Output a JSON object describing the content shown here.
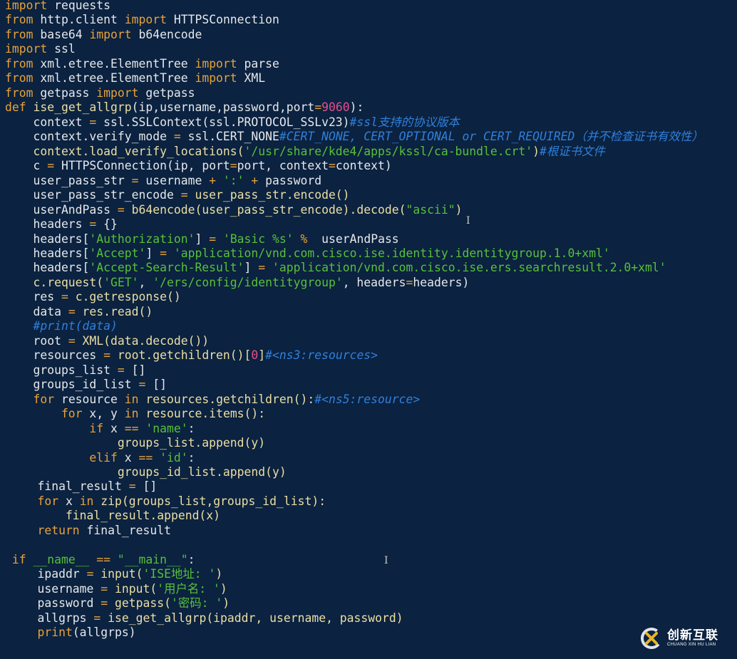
{
  "editor": {
    "lines": [
      [
        [
          "k",
          "import"
        ],
        [
          "p",
          " requests"
        ]
      ],
      [
        [
          "k",
          "from"
        ],
        [
          "p",
          " http.client "
        ],
        [
          "k",
          "import"
        ],
        [
          "p",
          " HTTPSConnection"
        ]
      ],
      [
        [
          "k",
          "from"
        ],
        [
          "p",
          " base64 "
        ],
        [
          "k",
          "import"
        ],
        [
          "p",
          " b64encode"
        ]
      ],
      [
        [
          "k",
          "import"
        ],
        [
          "p",
          " ssl"
        ]
      ],
      [
        [
          "k",
          "from"
        ],
        [
          "p",
          " xml.etree.ElementTree "
        ],
        [
          "k",
          "import"
        ],
        [
          "p",
          " parse"
        ]
      ],
      [
        [
          "k",
          "from"
        ],
        [
          "p",
          " xml.etree.ElementTree "
        ],
        [
          "k",
          "import"
        ],
        [
          "p",
          " XML"
        ]
      ],
      [
        [
          "k",
          "from"
        ],
        [
          "p",
          " getpass "
        ],
        [
          "k",
          "import"
        ],
        [
          "p",
          " getpass"
        ]
      ],
      [
        [
          "k",
          "def "
        ],
        [
          "f",
          "ise_get_allgrp"
        ],
        [
          "p",
          "(ip,username,password,port"
        ],
        [
          "o",
          "="
        ],
        [
          "n",
          "9060"
        ],
        [
          "p",
          "):"
        ]
      ],
      [
        [
          "p",
          "    context "
        ],
        [
          "o",
          "="
        ],
        [
          "p",
          " ssl.SSLContext(ssl.PROTOCOL_SSLv23)"
        ],
        [
          "c",
          "#ssl支持的协议版本"
        ]
      ],
      [
        [
          "p",
          "    context.verify_mode "
        ],
        [
          "o",
          "="
        ],
        [
          "p",
          " ssl.CERT_NONE"
        ],
        [
          "c",
          "#CERT_NONE, CERT_OPTIONAL or CERT_REQUIRED（并不检查证书有效性）"
        ]
      ],
      [
        [
          "f",
          "    context.load_verify_locations("
        ],
        [
          "s",
          "'/usr/share/kde4/apps/kssl/ca-bundle.crt'"
        ],
        [
          "f",
          ")"
        ],
        [
          "c",
          "#根证书文件"
        ]
      ],
      [
        [
          "p",
          "    c "
        ],
        [
          "o",
          "="
        ],
        [
          "p",
          " HTTPSConnection(ip, port"
        ],
        [
          "o",
          "="
        ],
        [
          "p",
          "port, context"
        ],
        [
          "o",
          "="
        ],
        [
          "p",
          "context)"
        ]
      ],
      [
        [
          "p",
          "    user_pass_str "
        ],
        [
          "o",
          "="
        ],
        [
          "p",
          " username "
        ],
        [
          "o",
          "+"
        ],
        [
          "s",
          " ':' "
        ],
        [
          "o",
          "+"
        ],
        [
          "p",
          " password"
        ]
      ],
      [
        [
          "p",
          "    user_pass_str_encode "
        ],
        [
          "o",
          "="
        ],
        [
          "f",
          " user_pass_str.encode()"
        ]
      ],
      [
        [
          "p",
          "    userAndPass "
        ],
        [
          "o",
          "="
        ],
        [
          "f",
          " b64encode(user_pass_str_encode).decode("
        ],
        [
          "s",
          "\"ascii\""
        ],
        [
          "f",
          ")"
        ]
      ],
      [
        [
          "p",
          "    headers "
        ],
        [
          "o",
          "="
        ],
        [
          "p",
          " {}"
        ]
      ],
      [
        [
          "p",
          "    headers["
        ],
        [
          "s",
          "'Authorization'"
        ],
        [
          "p",
          "] "
        ],
        [
          "o",
          "="
        ],
        [
          "s",
          " 'Basic %s'"
        ],
        [
          "o",
          " %"
        ],
        [
          "p",
          "  userAndPass"
        ]
      ],
      [
        [
          "p",
          "    headers["
        ],
        [
          "s",
          "'Accept'"
        ],
        [
          "p",
          "] "
        ],
        [
          "o",
          "="
        ],
        [
          "s",
          " 'application/vnd.com.cisco.ise.identity.identitygroup.1.0+xml'"
        ]
      ],
      [
        [
          "p",
          "    headers["
        ],
        [
          "s",
          "'Accept-Search-Result'"
        ],
        [
          "p",
          "] "
        ],
        [
          "o",
          "="
        ],
        [
          "s",
          " 'application/vnd.com.cisco.ise.ers.searchresult.2.0+xml'"
        ]
      ],
      [
        [
          "f",
          "    c.request("
        ],
        [
          "s",
          "'GET'"
        ],
        [
          "p",
          ", "
        ],
        [
          "s",
          "'/ers/config/identitygroup'"
        ],
        [
          "p",
          ", headers"
        ],
        [
          "o",
          "="
        ],
        [
          "p",
          "headers)"
        ]
      ],
      [
        [
          "p",
          "    res "
        ],
        [
          "o",
          "="
        ],
        [
          "f",
          " c.getresponse()"
        ]
      ],
      [
        [
          "p",
          "    data "
        ],
        [
          "o",
          "="
        ],
        [
          "f",
          " res.read()"
        ]
      ],
      [
        [
          "c",
          "    #print(data)"
        ]
      ],
      [
        [
          "p",
          "    root "
        ],
        [
          "o",
          "="
        ],
        [
          "f",
          " XML(data.decode())"
        ]
      ],
      [
        [
          "p",
          "    resources "
        ],
        [
          "o",
          "="
        ],
        [
          "f",
          " root.getchildren()["
        ],
        [
          "n",
          "0"
        ],
        [
          "f",
          "]"
        ],
        [
          "c",
          "#<ns3:resources>"
        ]
      ],
      [
        [
          "p",
          "    groups_list "
        ],
        [
          "o",
          "="
        ],
        [
          "p",
          " []"
        ]
      ],
      [
        [
          "p",
          "    groups_id_list "
        ],
        [
          "o",
          "="
        ],
        [
          "p",
          " []"
        ]
      ],
      [
        [
          "k",
          "    for"
        ],
        [
          "p",
          " resource "
        ],
        [
          "k",
          "in"
        ],
        [
          "f",
          " resources.getchildren():"
        ],
        [
          "c",
          "#<ns5:resource>"
        ]
      ],
      [
        [
          "k",
          "        for"
        ],
        [
          "p",
          " x, y "
        ],
        [
          "k",
          "in"
        ],
        [
          "f",
          " resource.items():"
        ]
      ],
      [
        [
          "k",
          "            if"
        ],
        [
          "p",
          " x "
        ],
        [
          "o",
          "=="
        ],
        [
          "s",
          " 'name'"
        ],
        [
          "p",
          ":"
        ]
      ],
      [
        [
          "f",
          "                groups_list.append(y)"
        ]
      ],
      [
        [
          "k",
          "            elif"
        ],
        [
          "p",
          " x "
        ],
        [
          "o",
          "=="
        ],
        [
          "s",
          " 'id'"
        ],
        [
          "p",
          ":"
        ]
      ],
      [
        [
          "f",
          "                groups_id_list.append(y)"
        ]
      ],
      [
        [
          "p",
          "    final_result "
        ],
        [
          "o",
          "="
        ],
        [
          "p",
          " []"
        ]
      ],
      [
        [
          "k",
          "    for"
        ],
        [
          "p",
          " x "
        ],
        [
          "k",
          "in"
        ],
        [
          "f",
          " zip(groups_list,groups_id_list):"
        ]
      ],
      [
        [
          "f",
          "        final_result.append(x)"
        ]
      ],
      [
        [
          "k",
          "    return"
        ],
        [
          "p",
          " final_result"
        ]
      ],
      [],
      [
        [
          "k",
          " if"
        ],
        [
          "s",
          " __name__ "
        ],
        [
          "o",
          "=="
        ],
        [
          "s",
          " \"__main__\""
        ],
        [
          "p",
          ":"
        ]
      ],
      [
        [
          "p",
          "    ipaddr "
        ],
        [
          "o",
          "="
        ],
        [
          "f",
          " input("
        ],
        [
          "s",
          "'ISE地址: '"
        ],
        [
          "f",
          ")"
        ]
      ],
      [
        [
          "p",
          "    username "
        ],
        [
          "o",
          "="
        ],
        [
          "f",
          " input("
        ],
        [
          "s",
          "'用户名: '"
        ],
        [
          "f",
          ")"
        ]
      ],
      [
        [
          "p",
          "    password "
        ],
        [
          "o",
          "="
        ],
        [
          "f",
          " getpass("
        ],
        [
          "s",
          "'密码: '"
        ],
        [
          "f",
          ")"
        ]
      ],
      [
        [
          "p",
          "    allgrps "
        ],
        [
          "o",
          "="
        ],
        [
          "f",
          " ise_get_allgrp(ipaddr, username, password)"
        ]
      ],
      [
        [
          "k",
          "    print"
        ],
        [
          "p",
          "(allgrps)"
        ]
      ]
    ]
  },
  "cursor_glyph": "I",
  "logo": {
    "name_cn": "创新互联",
    "name_en": "CHUANG XIN HU LIAN"
  },
  "colors": {
    "background": "#0b2240",
    "keyword": "#e8a23a",
    "string": "#58c03a",
    "number": "#e2508c",
    "comment": "#2f80dc",
    "call": "#ecdfa4",
    "text": "#e6e8ea"
  }
}
